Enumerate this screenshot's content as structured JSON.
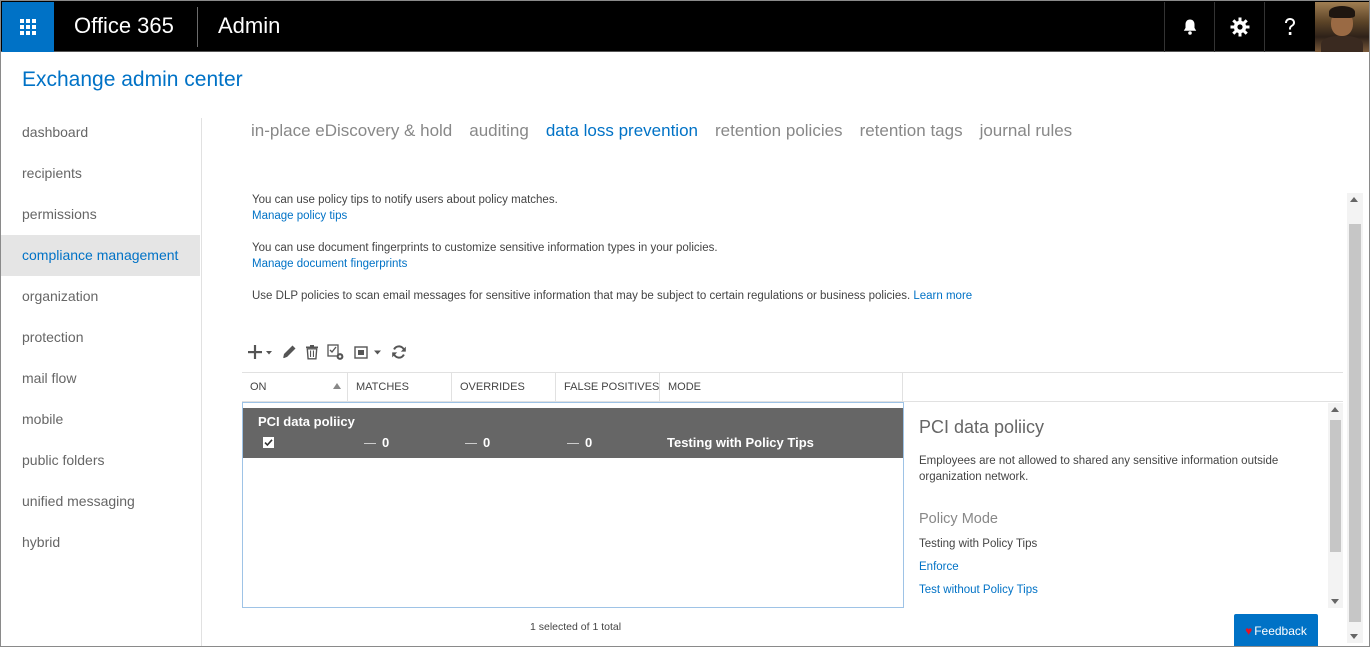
{
  "topbar": {
    "brand": "Office 365",
    "section": "Admin",
    "icons": [
      "app-launcher-icon",
      "bell-icon",
      "gear-icon",
      "help-icon"
    ],
    "accent_color": "#0072c6"
  },
  "header": {
    "title": "Exchange admin center"
  },
  "leftnav": {
    "items": [
      {
        "label": "dashboard"
      },
      {
        "label": "recipients"
      },
      {
        "label": "permissions"
      },
      {
        "label": "compliance management",
        "active": true
      },
      {
        "label": "organization"
      },
      {
        "label": "protection"
      },
      {
        "label": "mail flow"
      },
      {
        "label": "mobile"
      },
      {
        "label": "public folders"
      },
      {
        "label": "unified messaging"
      },
      {
        "label": "hybrid"
      }
    ]
  },
  "tabs": [
    {
      "label": "in-place eDiscovery & hold"
    },
    {
      "label": "auditing"
    },
    {
      "label": "data loss prevention",
      "active": true
    },
    {
      "label": "retention policies"
    },
    {
      "label": "retention tags"
    },
    {
      "label": "journal rules"
    }
  ],
  "info": {
    "policy_tips_text": "You can use policy tips to notify users about policy matches.",
    "policy_tips_link": "Manage policy tips",
    "fingerprints_text": "You can use document fingerprints to customize sensitive information types in your policies.",
    "fingerprints_link": "Manage document fingerprints",
    "dlp_text": "Use DLP policies to scan email messages for sensitive information that may be subject to certain regulations or business policies.",
    "learn_more": "Learn more"
  },
  "toolbar": {
    "icons": [
      "add-icon",
      "edit-icon",
      "delete-icon",
      "copy-icon",
      "import-icon",
      "refresh-icon"
    ]
  },
  "grid": {
    "columns": [
      "ON",
      "MATCHES",
      "OVERRIDES",
      "FALSE POSITIVES",
      "MODE"
    ],
    "sort_column": "ON",
    "rows": [
      {
        "name": "PCI data poliicy",
        "on": true,
        "matches": "0",
        "overrides": "0",
        "false_positives": "0",
        "mode": "Testing with Policy Tips",
        "selected": true
      }
    ],
    "status": "1 selected of 1 total"
  },
  "details": {
    "title": "PCI data poliicy",
    "description": "Employees are not allowed to shared any sensitive information outside organization network.",
    "policy_mode_label": "Policy Mode",
    "current_mode": "Testing with Policy Tips",
    "option_enforce": "Enforce",
    "option_test_without": "Test without Policy Tips"
  },
  "feedback": {
    "label": "Feedback"
  }
}
